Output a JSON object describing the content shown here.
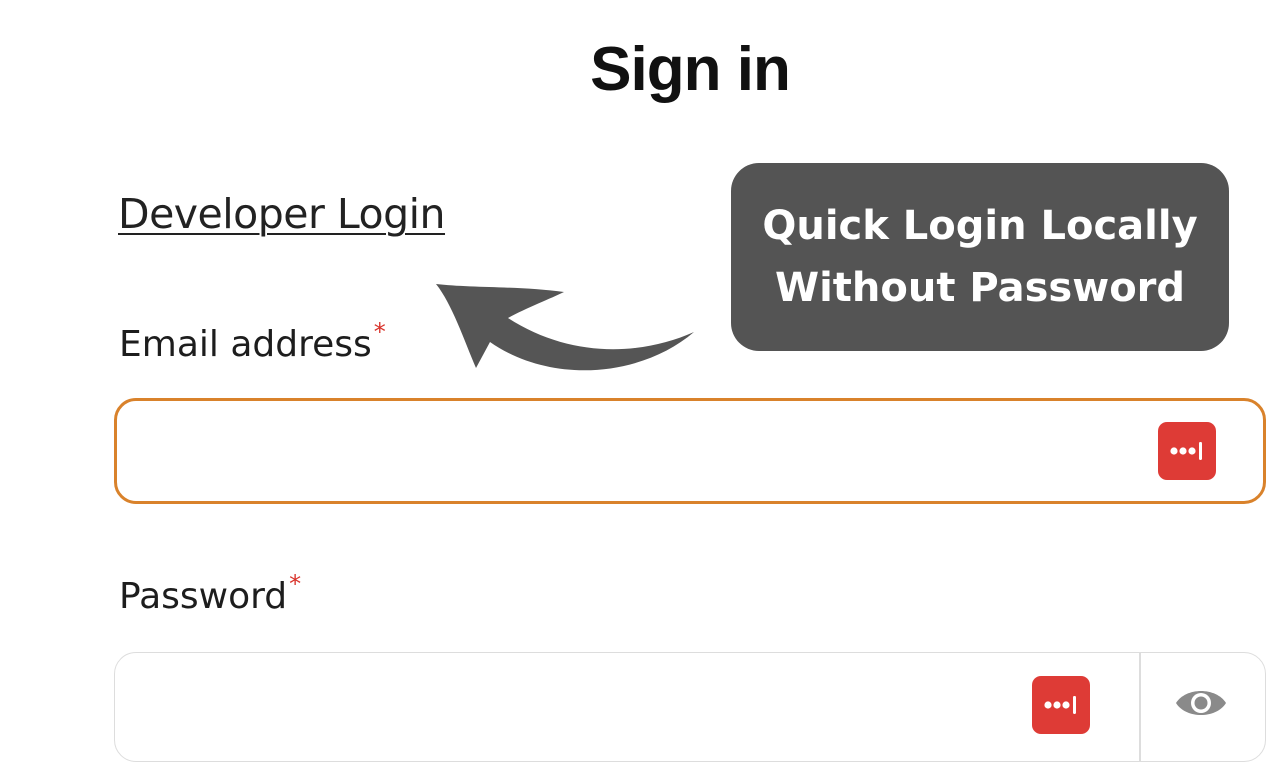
{
  "page": {
    "title": "Sign in"
  },
  "developer_login": {
    "label": "Developer Login"
  },
  "email": {
    "label": "Email address",
    "required_marker": "*",
    "value": "",
    "placeholder": ""
  },
  "password": {
    "label": "Password",
    "required_marker": "*",
    "value": "",
    "placeholder": ""
  },
  "callout": {
    "line1": "Quick Login Locally",
    "line2": "Without Password"
  },
  "icons": {
    "password_manager": "password-manager-icon",
    "show_password": "eye-icon",
    "annotation_arrow": "curved-arrow-icon"
  },
  "colors": {
    "email_focus_border": "#d9822b",
    "required_asterisk": "#d9332b",
    "password_manager_bg": "#de3b36",
    "callout_bg": "#545454",
    "arrow": "#555555"
  }
}
